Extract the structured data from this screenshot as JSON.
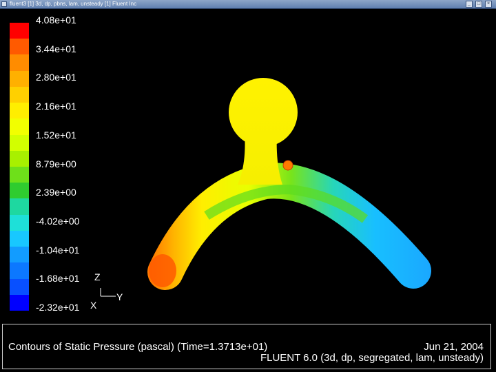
{
  "window": {
    "title": "fluent3 [1]  3d, dp, pbns, lam, unsteady  [1] Fluent Inc"
  },
  "colorbar": {
    "labels": [
      "4.08e+01",
      "3.44e+01",
      "2.80e+01",
      "2.16e+01",
      "1.52e+01",
      "8.79e+00",
      "2.39e+00",
      "-4.02e+00",
      "-1.04e+01",
      "-1.68e+01",
      "-2.32e+01"
    ],
    "colors": [
      "#ff0000",
      "#ff5a00",
      "#ff8c00",
      "#ffb000",
      "#ffd000",
      "#ffee00",
      "#f2ff00",
      "#d2ff00",
      "#a8f000",
      "#6ee01a",
      "#2fcc2f",
      "#1ed8a0",
      "#1ee0d8",
      "#18c8ff",
      "#129cff",
      "#0c78ff",
      "#0850ff",
      "#0000ff"
    ]
  },
  "axes": {
    "z": "Z",
    "y": "Y",
    "x": "X"
  },
  "status": {
    "left": "Contours of Static Pressure (pascal)  (Time=1.3713e+01)",
    "date": "Jun 21, 2004",
    "version": "FLUENT 6.0 (3d, dp, segregated, lam, unsteady)"
  }
}
